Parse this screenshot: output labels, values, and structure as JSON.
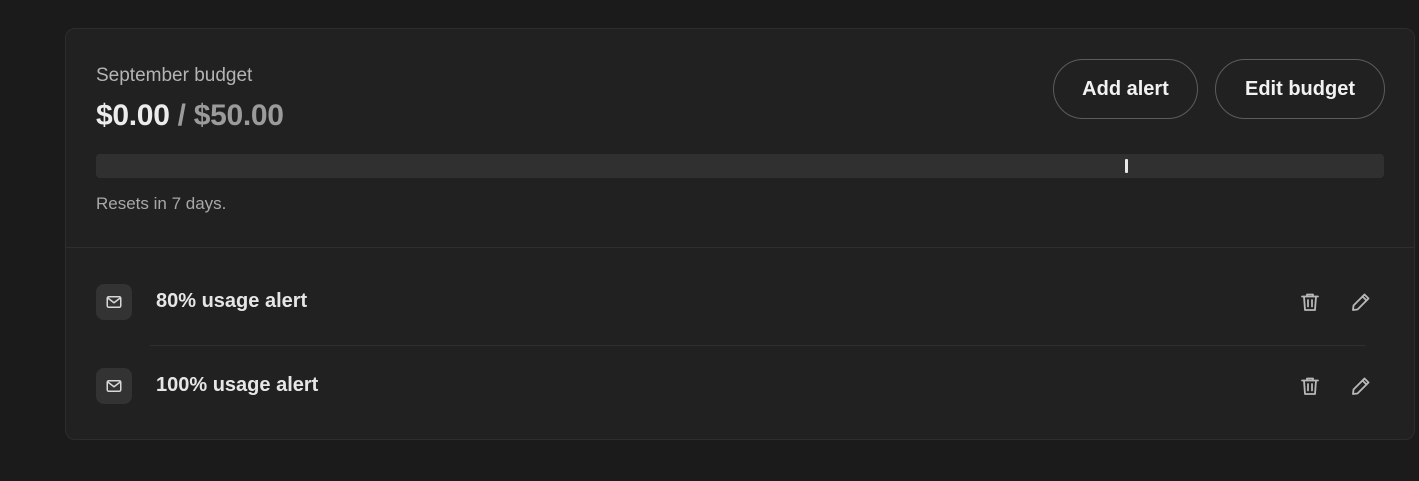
{
  "budget": {
    "title": "September budget",
    "spent": "$0.00",
    "separator": " / ",
    "limit": "$50.00",
    "resets_text": "Resets in 7 days.",
    "usage_fraction": 0.0,
    "alert_threshold_fraction": 0.8
  },
  "actions": {
    "add_alert_label": "Add alert",
    "edit_budget_label": "Edit budget"
  },
  "alerts": [
    {
      "label": "80% usage alert",
      "icon": "mail-icon"
    },
    {
      "label": "100% usage alert",
      "icon": "mail-icon"
    }
  ],
  "row_actions": {
    "delete_icon": "trash-icon",
    "edit_icon": "pencil-icon"
  },
  "colors": {
    "background": "#1b1b1b",
    "card": "#212121",
    "track": "#303030",
    "marker": "#e8e8e8"
  }
}
